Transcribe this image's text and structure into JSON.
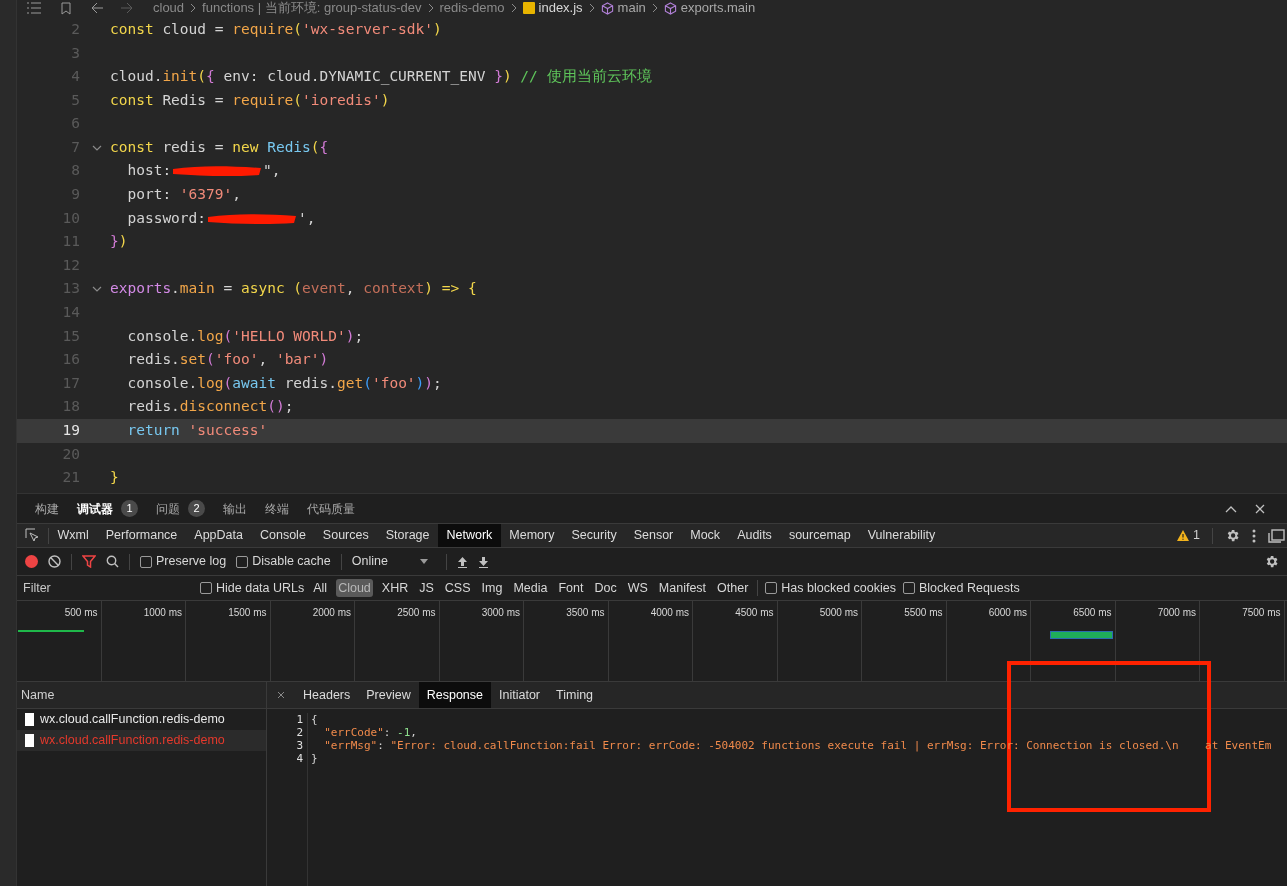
{
  "breadcrumb": [
    {
      "label": "cloud",
      "kind": "folder"
    },
    {
      "label": "functions | 当前环境: group-status-dev",
      "kind": "folder"
    },
    {
      "label": "redis-demo",
      "kind": "folder"
    },
    {
      "label": "index.js",
      "kind": "file"
    },
    {
      "label": "main",
      "kind": "symbol"
    },
    {
      "label": "exports.main",
      "kind": "symbol"
    }
  ],
  "code_lines": [
    {
      "num": "2",
      "current": false,
      "fold": false,
      "tokens": [
        {
          "kind": "kw",
          "t": "const"
        },
        {
          "kind": "plain",
          "t": " cloud = "
        },
        {
          "kind": "fn",
          "t": "require"
        },
        {
          "kind": "br1",
          "t": "("
        },
        {
          "kind": "str",
          "t": "'wx-server-sdk'"
        },
        {
          "kind": "br1",
          "t": ")"
        }
      ]
    },
    {
      "num": "3",
      "current": false,
      "fold": false
    },
    {
      "num": "4",
      "current": false,
      "fold": false,
      "tokens": [
        {
          "kind": "plain",
          "t": "cloud."
        },
        {
          "kind": "fn",
          "t": "init"
        },
        {
          "kind": "br1",
          "t": "("
        },
        {
          "kind": "br2",
          "t": "{"
        },
        {
          "kind": "plain",
          "t": " env: cloud.DYNAMIC_CURRENT_ENV "
        },
        {
          "kind": "br2",
          "t": "}"
        },
        {
          "kind": "br1",
          "t": ")"
        },
        {
          "kind": "cm",
          "t": " // 使用当前云环境"
        }
      ]
    },
    {
      "num": "5",
      "current": false,
      "fold": false,
      "tokens": [
        {
          "kind": "kw",
          "t": "const"
        },
        {
          "kind": "plain",
          "t": " Redis = "
        },
        {
          "kind": "fn",
          "t": "require"
        },
        {
          "kind": "br1",
          "t": "("
        },
        {
          "kind": "str",
          "t": "'ioredis'"
        },
        {
          "kind": "br1",
          "t": ")"
        }
      ]
    },
    {
      "num": "6",
      "current": false,
      "fold": false
    },
    {
      "num": "7",
      "current": false,
      "fold": true,
      "tokens": [
        {
          "kind": "kw",
          "t": "const"
        },
        {
          "kind": "plain",
          "t": " redis = "
        },
        {
          "kind": "kw",
          "t": "new"
        },
        {
          "kind": "cls",
          "t": " Redis"
        },
        {
          "kind": "br1",
          "t": "("
        },
        {
          "kind": "br2",
          "t": "{"
        }
      ]
    },
    {
      "num": "8",
      "current": false,
      "fold": false,
      "tokens": [
        {
          "kind": "plain",
          "t": "  host:"
        },
        {
          "kind": "redact"
        },
        {
          "kind": "plain",
          "t": "\","
        }
      ]
    },
    {
      "num": "9",
      "current": false,
      "fold": false,
      "tokens": [
        {
          "kind": "plain",
          "t": "  port: "
        },
        {
          "kind": "str",
          "t": "'6379'"
        },
        {
          "kind": "plain",
          "t": ","
        }
      ]
    },
    {
      "num": "10",
      "current": false,
      "fold": false,
      "tokens": [
        {
          "kind": "plain",
          "t": "  password:"
        },
        {
          "kind": "redact"
        },
        {
          "kind": "plain",
          "t": "',"
        }
      ]
    },
    {
      "num": "11",
      "current": false,
      "fold": false,
      "tokens": [
        {
          "kind": "br2",
          "t": "}"
        },
        {
          "kind": "br1",
          "t": ")"
        }
      ]
    },
    {
      "num": "12",
      "current": false,
      "fold": false
    },
    {
      "num": "13",
      "current": false,
      "fold": true,
      "tokens": [
        {
          "kind": "prop",
          "t": "exports"
        },
        {
          "kind": "plain",
          "t": "."
        },
        {
          "kind": "fn",
          "t": "main"
        },
        {
          "kind": "plain",
          "t": " = "
        },
        {
          "kind": "kw",
          "t": "async"
        },
        {
          "kind": "br1",
          "t": " ("
        },
        {
          "kind": "param",
          "t": "event"
        },
        {
          "kind": "plain",
          "t": ", "
        },
        {
          "kind": "param",
          "t": "context"
        },
        {
          "kind": "br1",
          "t": ")"
        },
        {
          "kind": "kw",
          "t": " =>"
        },
        {
          "kind": "br1",
          "t": " {"
        }
      ]
    },
    {
      "num": "14",
      "current": false,
      "fold": false
    },
    {
      "num": "15",
      "current": false,
      "fold": false,
      "tokens": [
        {
          "kind": "plain",
          "t": "  console."
        },
        {
          "kind": "fn",
          "t": "log"
        },
        {
          "kind": "br2",
          "t": "("
        },
        {
          "kind": "str",
          "t": "'HELLO WORLD'"
        },
        {
          "kind": "br2",
          "t": ")"
        },
        {
          "kind": "plain",
          "t": ";"
        }
      ]
    },
    {
      "num": "16",
      "current": false,
      "fold": false,
      "tokens": [
        {
          "kind": "plain",
          "t": "  redis."
        },
        {
          "kind": "fn",
          "t": "set"
        },
        {
          "kind": "br2",
          "t": "("
        },
        {
          "kind": "str",
          "t": "'foo'"
        },
        {
          "kind": "plain",
          "t": ", "
        },
        {
          "kind": "str",
          "t": "'bar'"
        },
        {
          "kind": "br2",
          "t": ")"
        }
      ]
    },
    {
      "num": "17",
      "current": false,
      "fold": false,
      "tokens": [
        {
          "kind": "plain",
          "t": "  console."
        },
        {
          "kind": "fn",
          "t": "log"
        },
        {
          "kind": "br2",
          "t": "("
        },
        {
          "kind": "cls",
          "t": "await"
        },
        {
          "kind": "plain",
          "t": " redis."
        },
        {
          "kind": "fn",
          "t": "get"
        },
        {
          "kind": "br3",
          "t": "("
        },
        {
          "kind": "str",
          "t": "'foo'"
        },
        {
          "kind": "br3",
          "t": ")"
        },
        {
          "kind": "br2",
          "t": ")"
        },
        {
          "kind": "plain",
          "t": ";"
        }
      ]
    },
    {
      "num": "18",
      "current": false,
      "fold": false,
      "tokens": [
        {
          "kind": "plain",
          "t": "  redis."
        },
        {
          "kind": "fn",
          "t": "disconnect"
        },
        {
          "kind": "br2",
          "t": "("
        },
        {
          "kind": "br2",
          "t": ")"
        },
        {
          "kind": "plain",
          "t": ";"
        }
      ]
    },
    {
      "num": "19",
      "current": true,
      "fold": false,
      "tokens": [
        {
          "kind": "cls",
          "t": "  return"
        },
        {
          "kind": "str",
          "t": " 'success'"
        }
      ]
    },
    {
      "num": "20",
      "current": false,
      "fold": false
    },
    {
      "num": "21",
      "current": false,
      "fold": false,
      "tokens": [
        {
          "kind": "br1",
          "t": "}"
        }
      ]
    }
  ],
  "panel_tabs": [
    {
      "label": "构建",
      "selected": false
    },
    {
      "label": "调试器",
      "badge": "1",
      "selected": true
    },
    {
      "label": "问题",
      "badge": "2",
      "selected": false
    },
    {
      "label": "输出",
      "selected": false
    },
    {
      "label": "终端",
      "selected": false
    },
    {
      "label": "代码质量",
      "selected": false
    }
  ],
  "devtools_tabs": [
    {
      "label": "Wxml",
      "selected": false
    },
    {
      "label": "Performance",
      "selected": false
    },
    {
      "label": "AppData",
      "selected": false
    },
    {
      "label": "Console",
      "selected": false
    },
    {
      "label": "Sources",
      "selected": false
    },
    {
      "label": "Storage",
      "selected": false
    },
    {
      "label": "Network",
      "selected": true
    },
    {
      "label": "Memory",
      "selected": false
    },
    {
      "label": "Security",
      "selected": false
    },
    {
      "label": "Sensor",
      "selected": false
    },
    {
      "label": "Mock",
      "selected": false
    },
    {
      "label": "Audits",
      "selected": false
    },
    {
      "label": "sourcemap",
      "selected": false
    },
    {
      "label": "Vulnerability",
      "selected": false
    }
  ],
  "warning_count": "1",
  "toolbar": {
    "recording": true,
    "preserve_log": {
      "label": "Preserve log",
      "checked": false
    },
    "disable_cache": {
      "label": "Disable cache",
      "checked": false
    },
    "throttling": "Online"
  },
  "filter": {
    "placeholder": "Filter",
    "hide_data_urls": {
      "label": "Hide data URLs",
      "checked": false
    },
    "types": [
      {
        "label": "All",
        "selected": false
      },
      {
        "label": "Cloud",
        "selected": true
      },
      {
        "label": "XHR",
        "selected": false
      },
      {
        "label": "JS",
        "selected": false
      },
      {
        "label": "CSS",
        "selected": false
      },
      {
        "label": "Img",
        "selected": false
      },
      {
        "label": "Media",
        "selected": false
      },
      {
        "label": "Font",
        "selected": false
      },
      {
        "label": "Doc",
        "selected": false
      },
      {
        "label": "WS",
        "selected": false
      },
      {
        "label": "Manifest",
        "selected": false
      },
      {
        "label": "Other",
        "selected": false
      }
    ],
    "has_blocked_cookies": {
      "label": "Has blocked cookies",
      "checked": false
    },
    "blocked_requests": {
      "label": "Blocked Requests",
      "checked": false
    }
  },
  "timeline_ticks": [
    "500 ms",
    "1000 ms",
    "1500 ms",
    "2000 ms",
    "2500 ms",
    "3000 ms",
    "3500 ms",
    "4000 ms",
    "4500 ms",
    "5000 ms",
    "5500 ms",
    "6000 ms",
    "6500 ms",
    "7000 ms",
    "7500 ms"
  ],
  "requests": {
    "column": "Name",
    "rows": [
      {
        "name": "wx.cloud.callFunction.redis-demo",
        "failed": false,
        "selected": false
      },
      {
        "name": "wx.cloud.callFunction.redis-demo",
        "failed": true,
        "selected": true
      }
    ]
  },
  "detail_tabs": [
    {
      "label": "Headers",
      "selected": false
    },
    {
      "label": "Preview",
      "selected": false
    },
    {
      "label": "Response",
      "selected": true
    },
    {
      "label": "Initiator",
      "selected": false
    },
    {
      "label": "Timing",
      "selected": false
    }
  ],
  "response_lines": [
    {
      "num": "1",
      "tokens": [
        {
          "kind": "plain",
          "t": "{"
        }
      ]
    },
    {
      "num": "2",
      "tokens": [
        {
          "kind": "key",
          "t": "  \"errCode\""
        },
        {
          "kind": "plain",
          "t": ": "
        },
        {
          "kind": "num",
          "t": "-1"
        },
        {
          "kind": "plain",
          "t": ","
        }
      ]
    },
    {
      "num": "3",
      "tokens": [
        {
          "kind": "key",
          "t": "  \"errMsg\""
        },
        {
          "kind": "plain",
          "t": ": "
        },
        {
          "kind": "str",
          "t": "\"Error: cloud.callFunction:fail Error: errCode: -504002 functions execute fail | errMsg: Error: Connection is closed.\\n    at EventEm"
        }
      ]
    },
    {
      "num": "4",
      "tokens": [
        {
          "kind": "plain",
          "t": "}"
        }
      ]
    }
  ]
}
